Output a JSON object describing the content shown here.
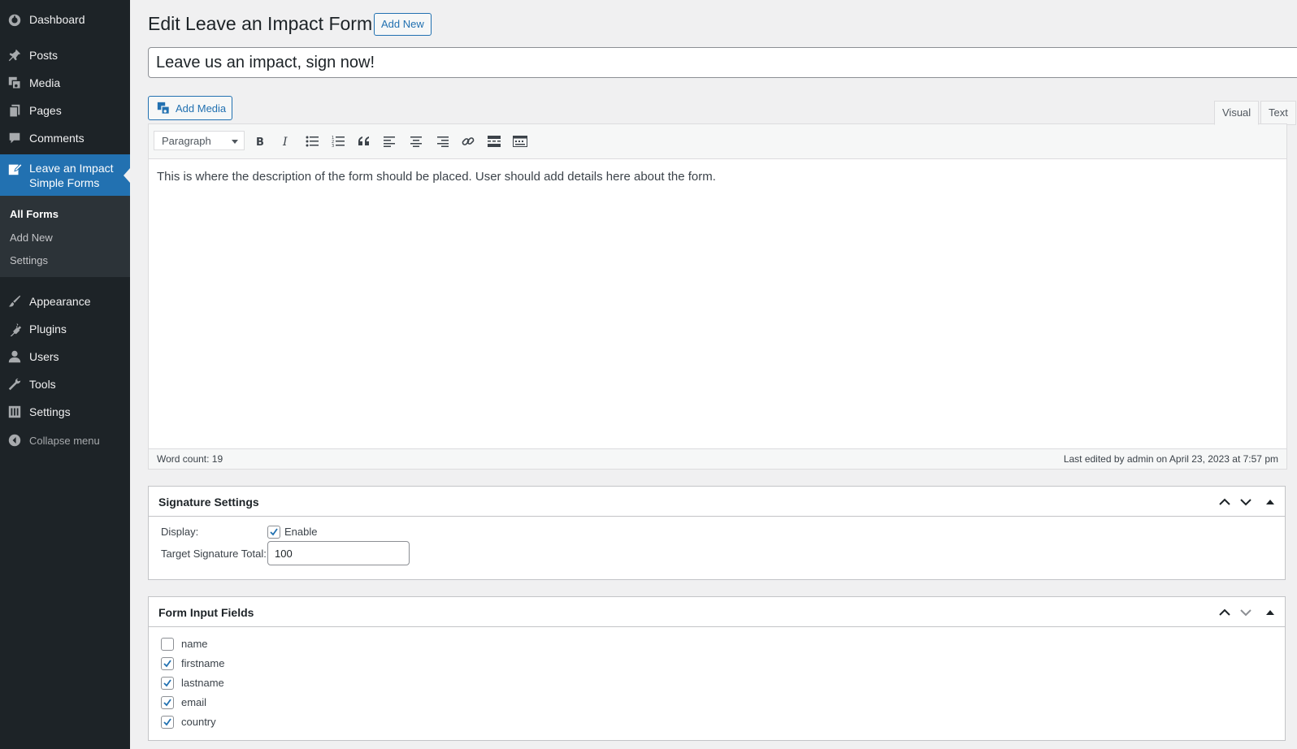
{
  "sidebar": {
    "items": [
      {
        "label": "Dashboard",
        "icon": "dashboard-icon"
      },
      {
        "label": "Posts",
        "icon": "pin-icon"
      },
      {
        "label": "Media",
        "icon": "media-icon"
      },
      {
        "label": "Pages",
        "icon": "pages-icon"
      },
      {
        "label": "Comments",
        "icon": "comment-icon"
      },
      {
        "label": "Leave an Impact Simple Forms",
        "icon": "edit-icon"
      },
      {
        "label": "Appearance",
        "icon": "brush-icon"
      },
      {
        "label": "Plugins",
        "icon": "plug-icon"
      },
      {
        "label": "Users",
        "icon": "user-icon"
      },
      {
        "label": "Tools",
        "icon": "wrench-icon"
      },
      {
        "label": "Settings",
        "icon": "settings-icon"
      }
    ],
    "submenu": [
      "All Forms",
      "Add New",
      "Settings"
    ],
    "collapse_label": "Collapse menu"
  },
  "header": {
    "title": "Edit Leave an Impact Form",
    "add_new_label": "Add New"
  },
  "post_title": "Leave us an impact, sign now!",
  "editor": {
    "add_media_label": "Add Media",
    "tabs": [
      "Visual",
      "Text"
    ],
    "active_tab": "Visual",
    "format_value": "Paragraph",
    "toolbar_icons": [
      "bold-icon",
      "italic-icon",
      "bullet-list-icon",
      "numbered-list-icon",
      "blockquote-icon",
      "align-left-icon",
      "align-center-icon",
      "align-right-icon",
      "link-icon",
      "read-more-icon",
      "toolbar-toggle-icon"
    ],
    "content": "This is where the description of the form should be placed. User should add details here about the form.",
    "word_count": "Word count: 19",
    "last_edited": "Last edited by admin on April 23, 2023 at 7:57 pm"
  },
  "signature_settings": {
    "title": "Signature Settings",
    "display_label": "Display:",
    "enable_label": "Enable",
    "enable_checked": true,
    "target_label": "Target Signature Total:",
    "target_value": "100"
  },
  "form_input_fields": {
    "title": "Form Input Fields",
    "fields": [
      {
        "label": "name",
        "checked": false
      },
      {
        "label": "firstname",
        "checked": true
      },
      {
        "label": "lastname",
        "checked": true
      },
      {
        "label": "email",
        "checked": true
      },
      {
        "label": "country",
        "checked": true
      }
    ]
  },
  "colors": {
    "sidebar_bg": "#1d2327",
    "accent": "#2271b1",
    "page_bg": "#f0f0f1"
  }
}
